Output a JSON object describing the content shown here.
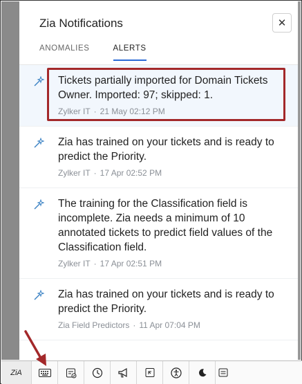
{
  "panel": {
    "title": "Zia Notifications",
    "close_glyph": "✕",
    "tabs": [
      {
        "label": "ANOMALIES",
        "active": false
      },
      {
        "label": "ALERTS",
        "active": true
      }
    ]
  },
  "notifications": [
    {
      "message": "Tickets partially imported for Domain Tickets Owner. Imported: 97; skipped: 1.",
      "source": "Zylker IT",
      "time": "21 May 02:12 PM",
      "icon": "magic-wand-icon"
    },
    {
      "message": "Zia has trained on your tickets and is ready to predict the Priority.",
      "source": "Zylker IT",
      "time": "17 Apr 02:52 PM",
      "icon": "magic-wand-icon"
    },
    {
      "message": "The training for the Classification field is incomplete. Zia needs a minimum of 10 annotated tickets to predict field values of the Classification field.",
      "source": "Zylker IT",
      "time": "17 Apr 02:51 PM",
      "icon": "magic-wand-icon"
    },
    {
      "message": "Zia has trained on your tickets and is ready to predict the Priority.",
      "source": "Zia Field Predictors",
      "time": "11 Apr 07:04 PM",
      "icon": "magic-wand-icon"
    }
  ],
  "separator": "·",
  "toolbar": {
    "zia_label": "ZiA",
    "icons": [
      "zia-icon",
      "keyboard-icon",
      "tickets-icon",
      "clock-icon",
      "megaphone-icon",
      "reply-icon",
      "accessibility-icon",
      "moon-icon",
      "archive-icon"
    ]
  },
  "colors": {
    "accent": "#2a6ad6",
    "highlight_row": "#f2f7fd",
    "annotation_red": "#a3282a"
  }
}
